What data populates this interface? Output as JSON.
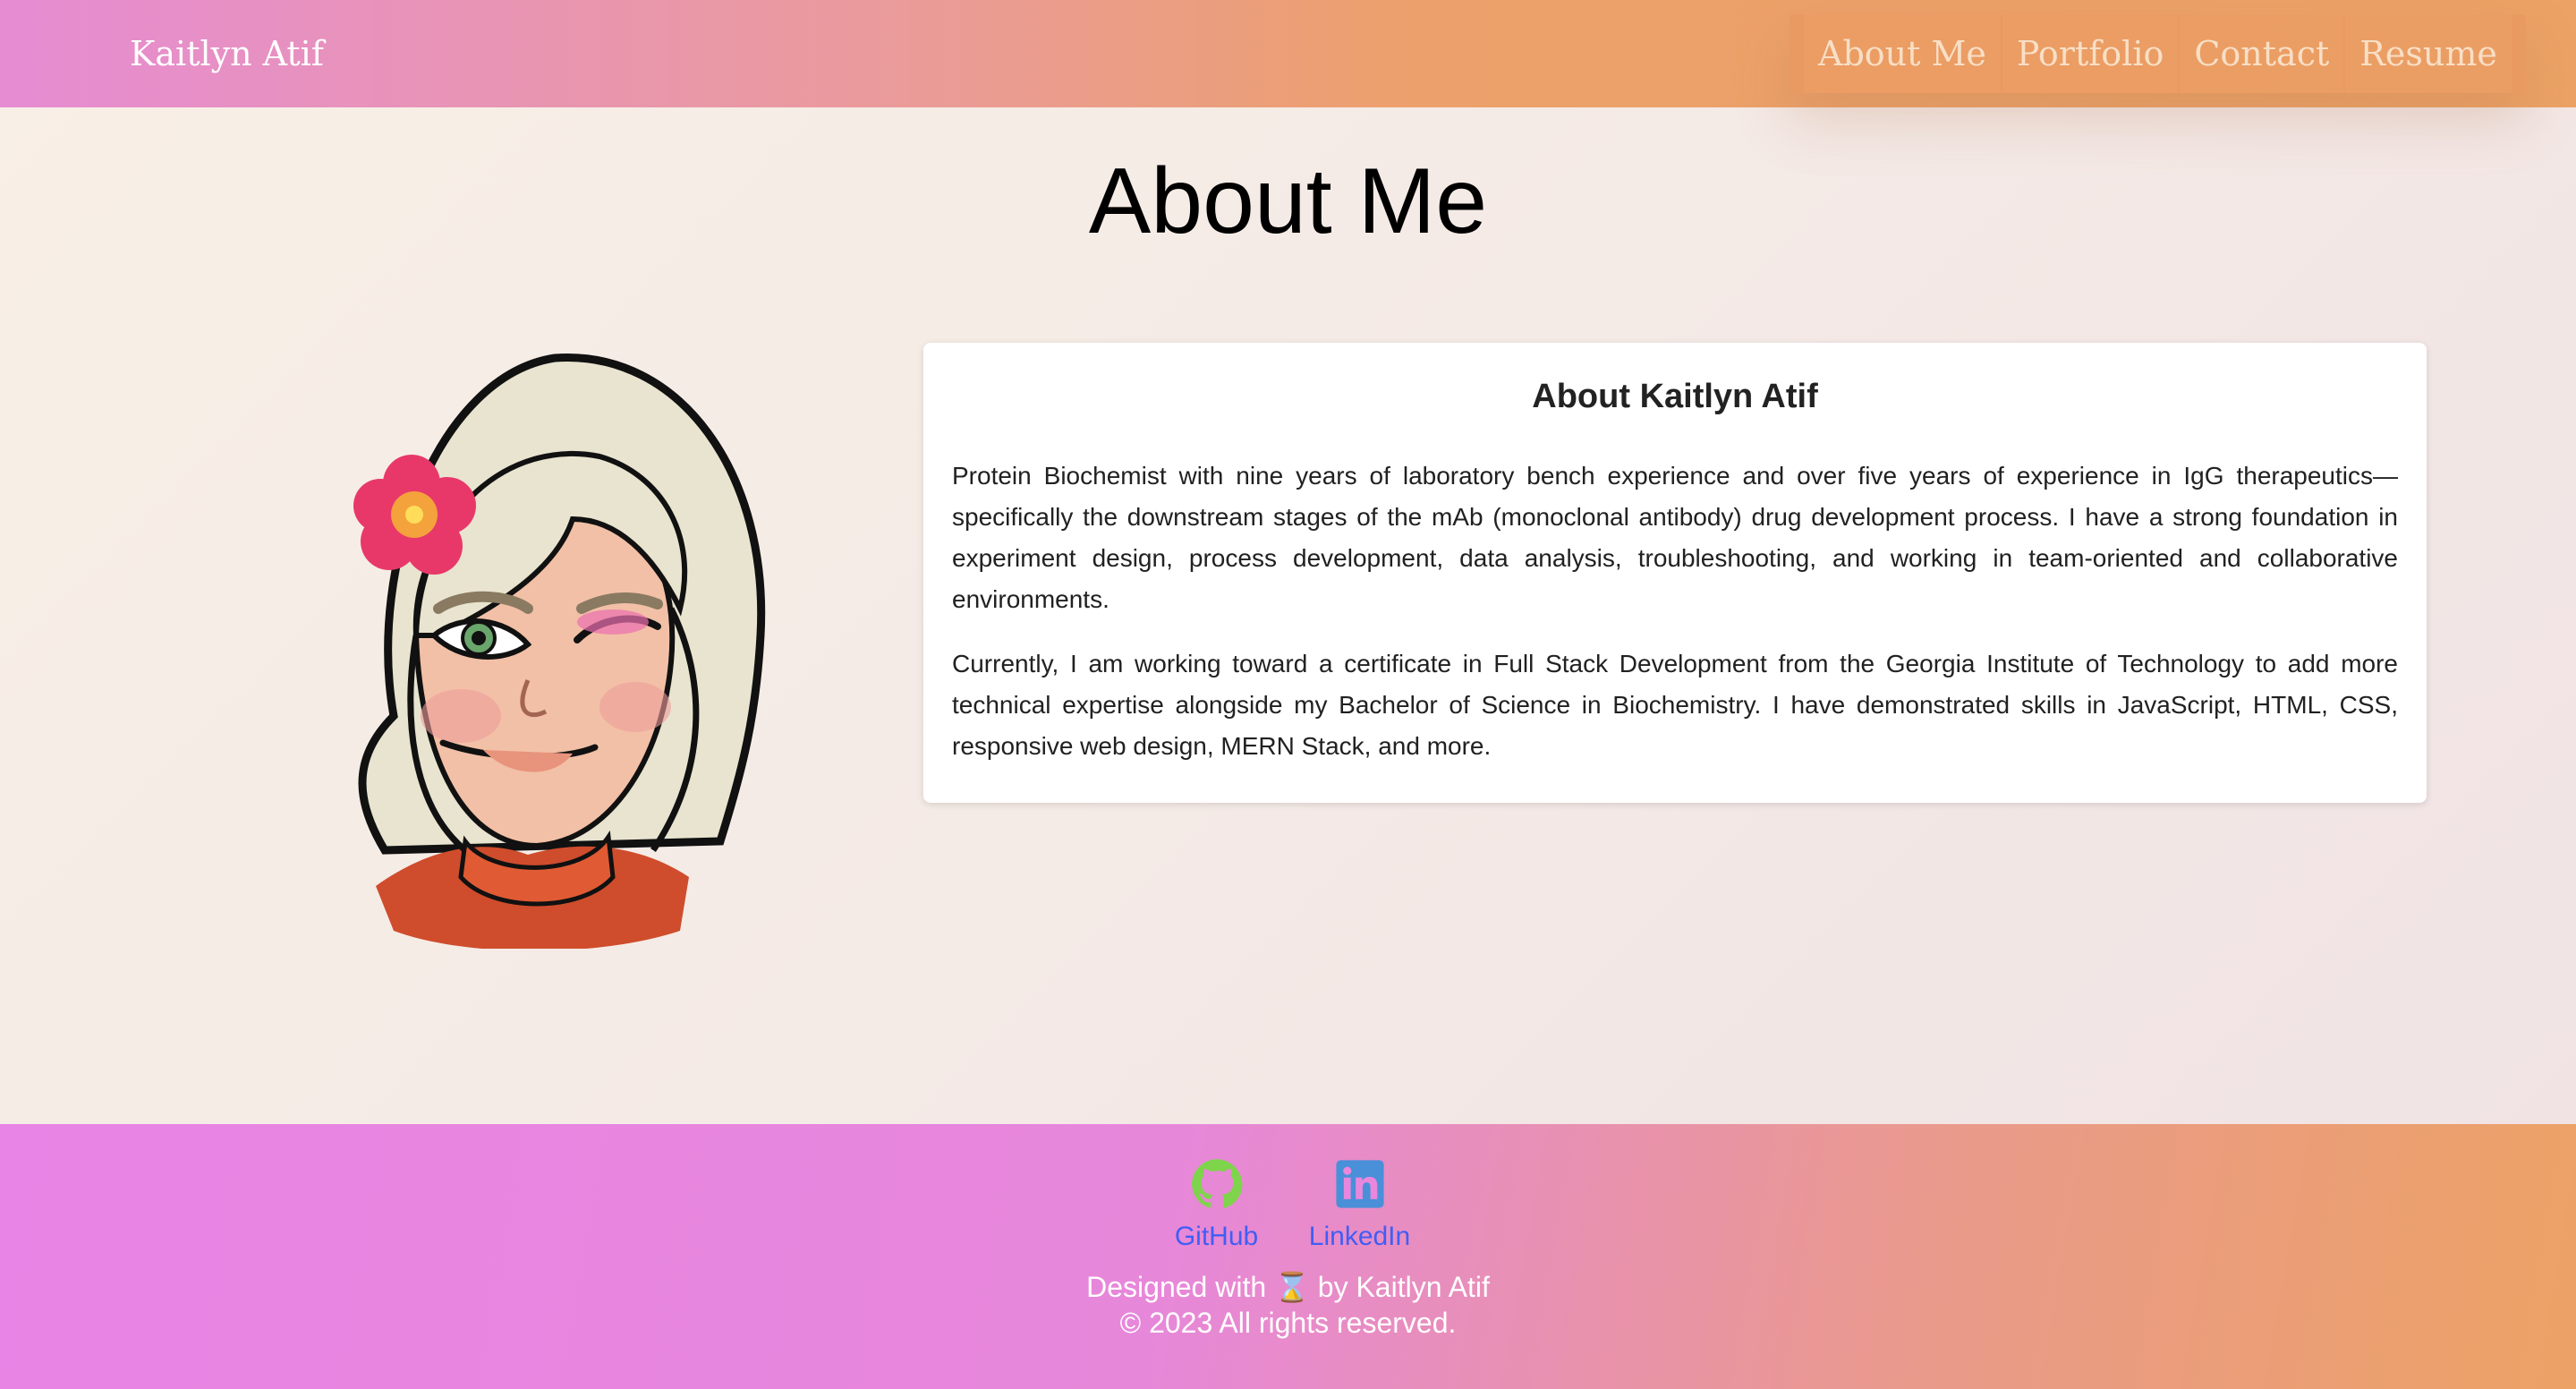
{
  "header": {
    "brand": "Kaitlyn Atif",
    "nav": [
      "About Me",
      "Portfolio",
      "Contact",
      "Resume"
    ]
  },
  "main": {
    "title": "About Me",
    "avatar_icon": "bitmoji-avatar",
    "card": {
      "title": "About Kaitlyn Atif",
      "paragraphs": [
        "Protein Biochemist with nine years of laboratory bench experience and over five years of experience in IgG therapeutics—specifically the downstream stages of the mAb (monoclonal antibody) drug development process. I have a strong foundation in experiment design, process development, data analysis, troubleshooting, and working in team-oriented and collaborative environments.",
        "Currently, I am working toward a certificate in Full Stack Development from the Georgia Institute of Technology to add more technical expertise alongside my Bachelor of Science in Biochemistry. I have demonstrated skills in JavaScript, HTML, CSS, responsive web design, MERN Stack, and more."
      ]
    }
  },
  "footer": {
    "links": [
      {
        "label": "GitHub",
        "icon": "github-icon",
        "color": "#7ed44a"
      },
      {
        "label": "LinkedIn",
        "icon": "linkedin-icon",
        "color": "#4a90d9"
      }
    ],
    "credit_line1": "Designed with ⌛ by Kaitlyn Atif",
    "credit_line2": "© 2023 All rights reserved."
  },
  "colors": {
    "header_gradient_start": "#e68cd3",
    "header_gradient_end": "#eca265",
    "link_blue": "#3f5ef5"
  }
}
